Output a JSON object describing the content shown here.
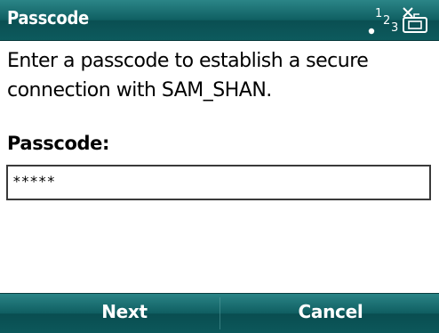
{
  "window": {
    "title": "Passcode"
  },
  "status": {
    "icons": [
      "signal-icon",
      "network-1-2-3-icon",
      "no-sim-icon"
    ],
    "network_text": [
      "1",
      "2",
      "3"
    ]
  },
  "dialog": {
    "prompt": "Enter a passcode to establish a secure connection with SAM_SHAN.",
    "field_label": "Passcode:",
    "field_value": "*****"
  },
  "softkeys": {
    "left_label": "Next",
    "right_label": "Cancel"
  },
  "colors": {
    "bar_teal": "#0f5f62",
    "bar_teal_light": "#2b8587",
    "text": "#000000",
    "bar_text": "#ffffff"
  }
}
